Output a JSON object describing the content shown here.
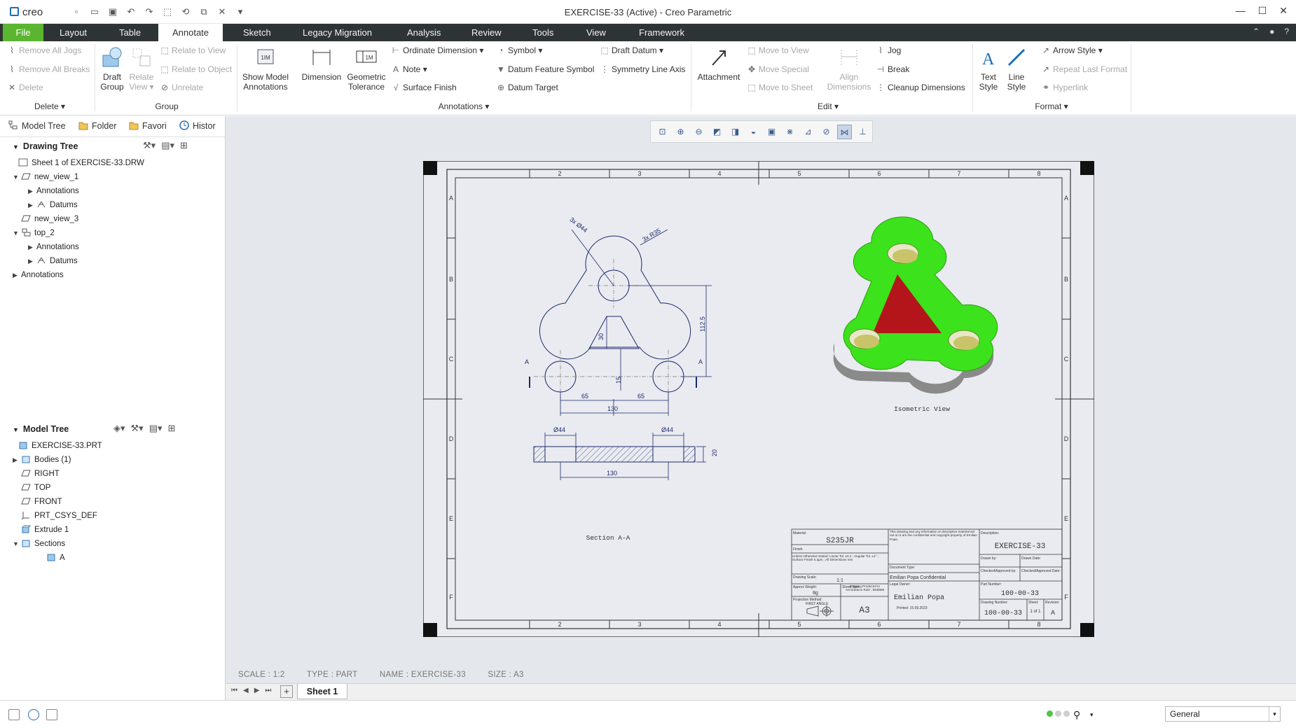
{
  "app": {
    "logo": "creo",
    "window_title": "EXERCISE-33 (Active) - Creo Parametric"
  },
  "tabs": [
    {
      "label": "File"
    },
    {
      "label": "Layout"
    },
    {
      "label": "Table"
    },
    {
      "label": "Annotate"
    },
    {
      "label": "Sketch"
    },
    {
      "label": "Legacy Migration"
    },
    {
      "label": "Analysis"
    },
    {
      "label": "Review"
    },
    {
      "label": "Tools"
    },
    {
      "label": "View"
    },
    {
      "label": "Framework"
    }
  ],
  "ribbon": {
    "delete_group": {
      "remove_all_jogs": "Remove All Jogs",
      "remove_all_breaks": "Remove All Breaks",
      "delete": "Delete",
      "label": "Delete"
    },
    "group_group": {
      "draft_group": "Draft Group",
      "relate_view": "Relate View",
      "relate_to_view": "Relate to View",
      "relate_to_object": "Relate to Object",
      "unrelate": "Unrelate",
      "label": "Group"
    },
    "annotations_group": {
      "show_model_annotations": "Show Model Annotations",
      "dimension": "Dimension",
      "geometric_tolerance": "Geometric Tolerance",
      "ordinate_dimension": "Ordinate Dimension",
      "note": "Note",
      "surface_finish": "Surface Finish",
      "symbol": "Symbol",
      "datum_feature_symbol": "Datum Feature Symbol",
      "datum_target": "Datum Target",
      "draft_datum": "Draft Datum",
      "symmetry_line_axis": "Symmetry Line Axis",
      "label": "Annotations"
    },
    "edit_group": {
      "attachment": "Attachment",
      "move_to_view": "Move to View",
      "move_special": "Move Special",
      "move_to_sheet": "Move to Sheet",
      "align_dimensions": "Align Dimensions",
      "jog": "Jog",
      "break": "Break",
      "cleanup_dimensions": "Cleanup Dimensions",
      "label": "Edit"
    },
    "format_group": {
      "text_style": "Text Style",
      "line_style": "Line Style",
      "arrow_style": "Arrow Style",
      "repeat_last_format": "Repeat Last Format",
      "hyperlink": "Hyperlink",
      "label": "Format"
    }
  },
  "left_panel": {
    "tabs": [
      {
        "label": "Model Tree"
      },
      {
        "label": "Folder"
      },
      {
        "label": "Favori"
      },
      {
        "label": "Histor"
      }
    ],
    "drawing_tree": {
      "header": "Drawing Tree",
      "nodes": [
        {
          "label": "Sheet 1 of EXERCISE-33.DRW"
        },
        {
          "label": "new_view_1"
        },
        {
          "label": "Annotations"
        },
        {
          "label": "Datums"
        },
        {
          "label": "new_view_3"
        },
        {
          "label": "top_2"
        },
        {
          "label": "Annotations"
        },
        {
          "label": "Datums"
        },
        {
          "label": "Annotations"
        }
      ]
    },
    "model_tree": {
      "header": "Model Tree",
      "nodes": [
        {
          "label": "EXERCISE-33.PRT"
        },
        {
          "label": "Bodies (1)"
        },
        {
          "label": "RIGHT"
        },
        {
          "label": "TOP"
        },
        {
          "label": "FRONT"
        },
        {
          "label": "PRT_CSYS_DEF"
        },
        {
          "label": "Extrude 1"
        },
        {
          "label": "Sections"
        },
        {
          "label": "A"
        }
      ]
    }
  },
  "drawing": {
    "zone_cols": [
      "2",
      "3",
      "4",
      "5",
      "6",
      "7",
      "8"
    ],
    "zone_rows": [
      "A",
      "B",
      "C",
      "D",
      "E",
      "F"
    ],
    "dims": {
      "hole_dia": "3x Ø44",
      "radius": "3x R35",
      "height": "112.5",
      "inner": "30",
      "offset": "15",
      "left_half": "65",
      "right_half": "65",
      "overall_front": "130",
      "sec_dia_left": "Ø44",
      "sec_dia_right": "Ø44",
      "thickness": "20",
      "overall_sec": "130",
      "section_marker": "A"
    },
    "labels": {
      "isometric": "Isometric View",
      "section": "Section A-A"
    },
    "title_block": {
      "material_label": "Material:",
      "material": "S235JR",
      "finish_label": "Finish:",
      "tolerance_note": "Unless Otherwise Stated: Linear Tol. ±0.2 ; Angular Tol. ±1° ; Surface Finish 6.3µm ; All Dimensions mm",
      "drawing_scale_label": "Drawing Scale:",
      "scale": "1:1",
      "approx_weight_label": "Approx Weight:",
      "weight": "8g",
      "drawing_produced_label": "Drawing Produced to Accordance Rule : BS8888",
      "projection_label": "Projection Method:",
      "projection": "FIRST ANGLE",
      "sheet_size_label": "Sheet Size:",
      "sheet_size": "A3",
      "legal_text": "This drawing and any information or descriptive material set out on it are the confidential and copyright property of Emilian Popa.",
      "document_type_label": "Document Type:",
      "confidential": "Emilian Popa Confidential",
      "legal_owner_label": "Legal Owner:",
      "owner": "Emilian Popa",
      "printed_note": "Printed: 15.09.2023",
      "description_label": "Description:",
      "description": "EXERCISE-33",
      "drawn_by_label": "Drawn by:",
      "drawn_date_label": "Drawn Date:",
      "checked_label": "Checked/Approved by:",
      "checked_date_label": "Checked/Approved Date:",
      "part_number_label": "Part Number:",
      "part_number": "100-00-33",
      "drawing_number_label": "Drawing Number:",
      "drawing_number": "100-00-33",
      "sheet_label": "Sheet:",
      "sheet": "1 of 1",
      "revision_label": "Revision:",
      "revision": "A"
    }
  },
  "sheet_info": {
    "scale": "SCALE : 1:2",
    "type": "TYPE : PART",
    "name": "NAME : EXERCISE-33",
    "size": "SIZE : A3"
  },
  "sheet_tabs": [
    {
      "label": "Sheet 1"
    }
  ],
  "status": {
    "filter": "General"
  },
  "colors": {
    "file_tab": "#5cb531",
    "tabbar": "#2e3436",
    "canvas_bg": "#e4e7ec",
    "part_green": "#3ce21c",
    "part_red": "#b3151b",
    "drawing_line": "#1d2a6b"
  }
}
